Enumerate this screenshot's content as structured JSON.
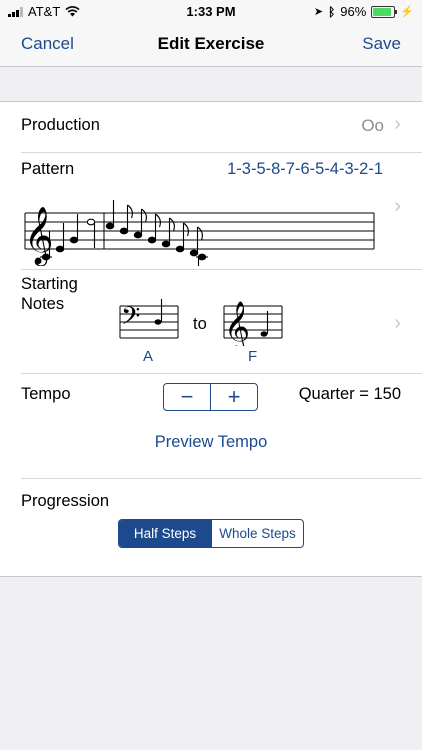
{
  "status": {
    "carrier": "AT&T",
    "time": "1:33 PM",
    "battery": "96%",
    "battery_level": 0.96
  },
  "nav": {
    "cancel": "Cancel",
    "title": "Edit Exercise",
    "save": "Save"
  },
  "production": {
    "label": "Production",
    "value": "Oo"
  },
  "pattern": {
    "label": "Pattern",
    "value": "1-3-5-8-7-6-5-4-3-2-1"
  },
  "starting_notes": {
    "label_line1": "Starting",
    "label_line2": "Notes",
    "from_note": "A",
    "to_word": "to",
    "to_note": "F"
  },
  "tempo": {
    "label": "Tempo",
    "minus": "−",
    "plus": "+",
    "value": "Quarter = 150",
    "preview": "Preview Tempo"
  },
  "progression": {
    "label": "Progression",
    "options": [
      "Half Steps",
      "Whole Steps"
    ],
    "selected": "Half Steps"
  },
  "colors": {
    "accent": "#1c4a8c",
    "separator": "#d8d8dc",
    "background": "#efeff4"
  },
  "icons": {
    "chevron": "chevron-right-icon",
    "treble_clef": "treble-clef-icon",
    "bass_clef": "bass-clef-icon"
  }
}
